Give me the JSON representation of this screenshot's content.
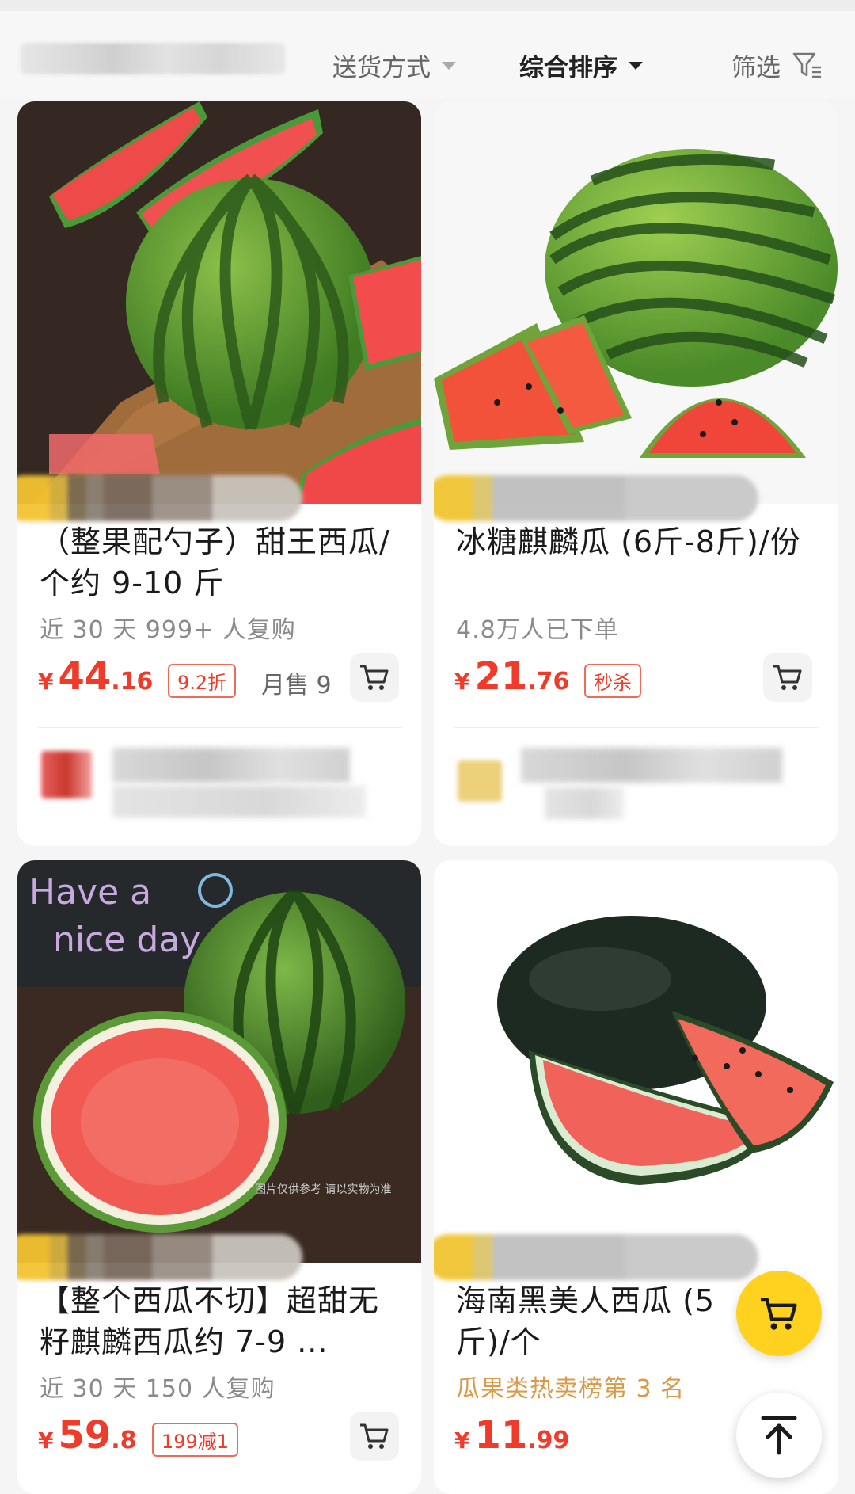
{
  "filter_bar": {
    "delivery": "送货方式",
    "sort": "综合排序",
    "filter": "筛选"
  },
  "products": [
    {
      "title": "（整果配勺子）甜王西瓜/个约 9-10 斤",
      "sub": "近 30 天 999+ 人复购",
      "price_currency": "¥",
      "price_int": "44",
      "price_dec": ".16",
      "badge": "9.2折",
      "sold": "月售 9"
    },
    {
      "title": "冰糖麒麟瓜 (6斤-8斤)/份",
      "sub": "4.8万人已下单",
      "price_currency": "¥",
      "price_int": "21",
      "price_dec": ".76",
      "badge": "秒杀"
    },
    {
      "title": "【整个西瓜不切】超甜无籽麒麟西瓜约 7-9 ...",
      "sub": "近 30 天 150 人复购",
      "price_currency": "¥",
      "price_int": "59",
      "price_dec": ".8",
      "badge": "199减1",
      "image_text_line1": "Have a",
      "image_text_line2": "nice day",
      "image_notice": "图片仅供参考 请以实物为准"
    },
    {
      "title": "海南黑美人西瓜 (5斤)/个",
      "sub": "瓜果类热卖榜第 3 名",
      "price_currency": "¥",
      "price_int": "11",
      "price_dec": ".99"
    }
  ],
  "icons": {
    "dropdown": "triangle-down-icon",
    "filter": "funnel-icon",
    "cart": "cart-icon",
    "back_to_top": "arrow-up-icon"
  },
  "colors": {
    "price": "#f03a2a",
    "accent": "#ffd21f",
    "hot_rank": "#d99a4a"
  }
}
